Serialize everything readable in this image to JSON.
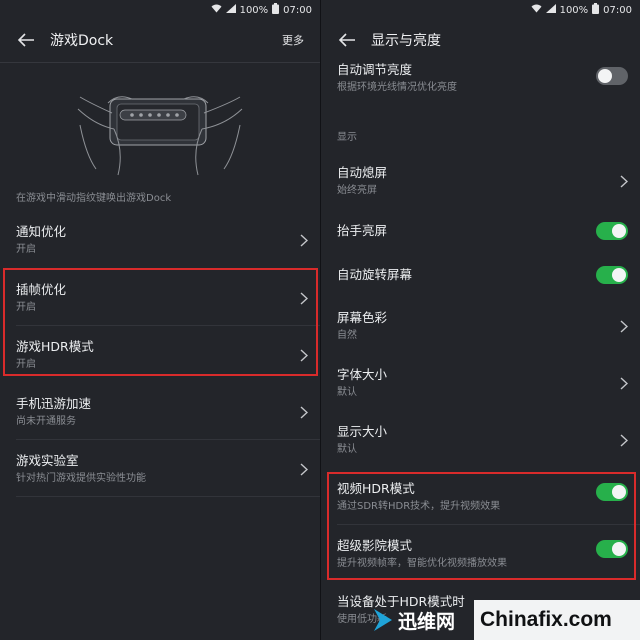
{
  "status_bar": {
    "battery": "100%",
    "time": "07:00"
  },
  "left": {
    "title": "游戏Dock",
    "more": "更多",
    "illustration_caption": "在游戏中滑动指纹键唤出游戏Dock",
    "items": [
      {
        "title": "通知优化",
        "subtitle": "开启"
      },
      {
        "title": "插帧优化",
        "subtitle": "开启"
      },
      {
        "title": "游戏HDR模式",
        "subtitle": "开启"
      },
      {
        "title": "手机迅游加速",
        "subtitle": "尚未开通服务"
      },
      {
        "title": "游戏实验室",
        "subtitle": "针对热门游戏提供实验性功能"
      }
    ]
  },
  "right": {
    "title": "显示与亮度",
    "auto_brightness": {
      "title": "自动调节亮度",
      "subtitle": "根据环境光线情况优化亮度",
      "on": false
    },
    "section_label": "显示",
    "items": [
      {
        "title": "自动熄屏",
        "subtitle": "始终亮屏",
        "control": "chevron"
      },
      {
        "title": "抬手亮屏",
        "subtitle": "",
        "control": "toggle",
        "on": true
      },
      {
        "title": "自动旋转屏幕",
        "subtitle": "",
        "control": "toggle",
        "on": true
      },
      {
        "title": "屏幕色彩",
        "subtitle": "自然",
        "control": "chevron"
      },
      {
        "title": "字体大小",
        "subtitle": "默认",
        "control": "chevron"
      },
      {
        "title": "显示大小",
        "subtitle": "默认",
        "control": "chevron"
      },
      {
        "title": "视频HDR模式",
        "subtitle": "通过SDR转HDR技术，提升视频效果",
        "control": "toggle",
        "on": true
      },
      {
        "title": "超级影院模式",
        "subtitle": "提升视频帧率，智能优化视频播放效果",
        "control": "toggle",
        "on": true
      }
    ],
    "partial_item": {
      "title": "当设备处于HDR模式时",
      "subtitle": "使用低功耗"
    }
  },
  "watermark": {
    "text1": "迅维网",
    "text2": "Chinafix.com"
  },
  "colors": {
    "background": "#23252a",
    "toggle_on": "#27b04b",
    "toggle_off": "#606368",
    "highlight": "#d92b2b"
  }
}
